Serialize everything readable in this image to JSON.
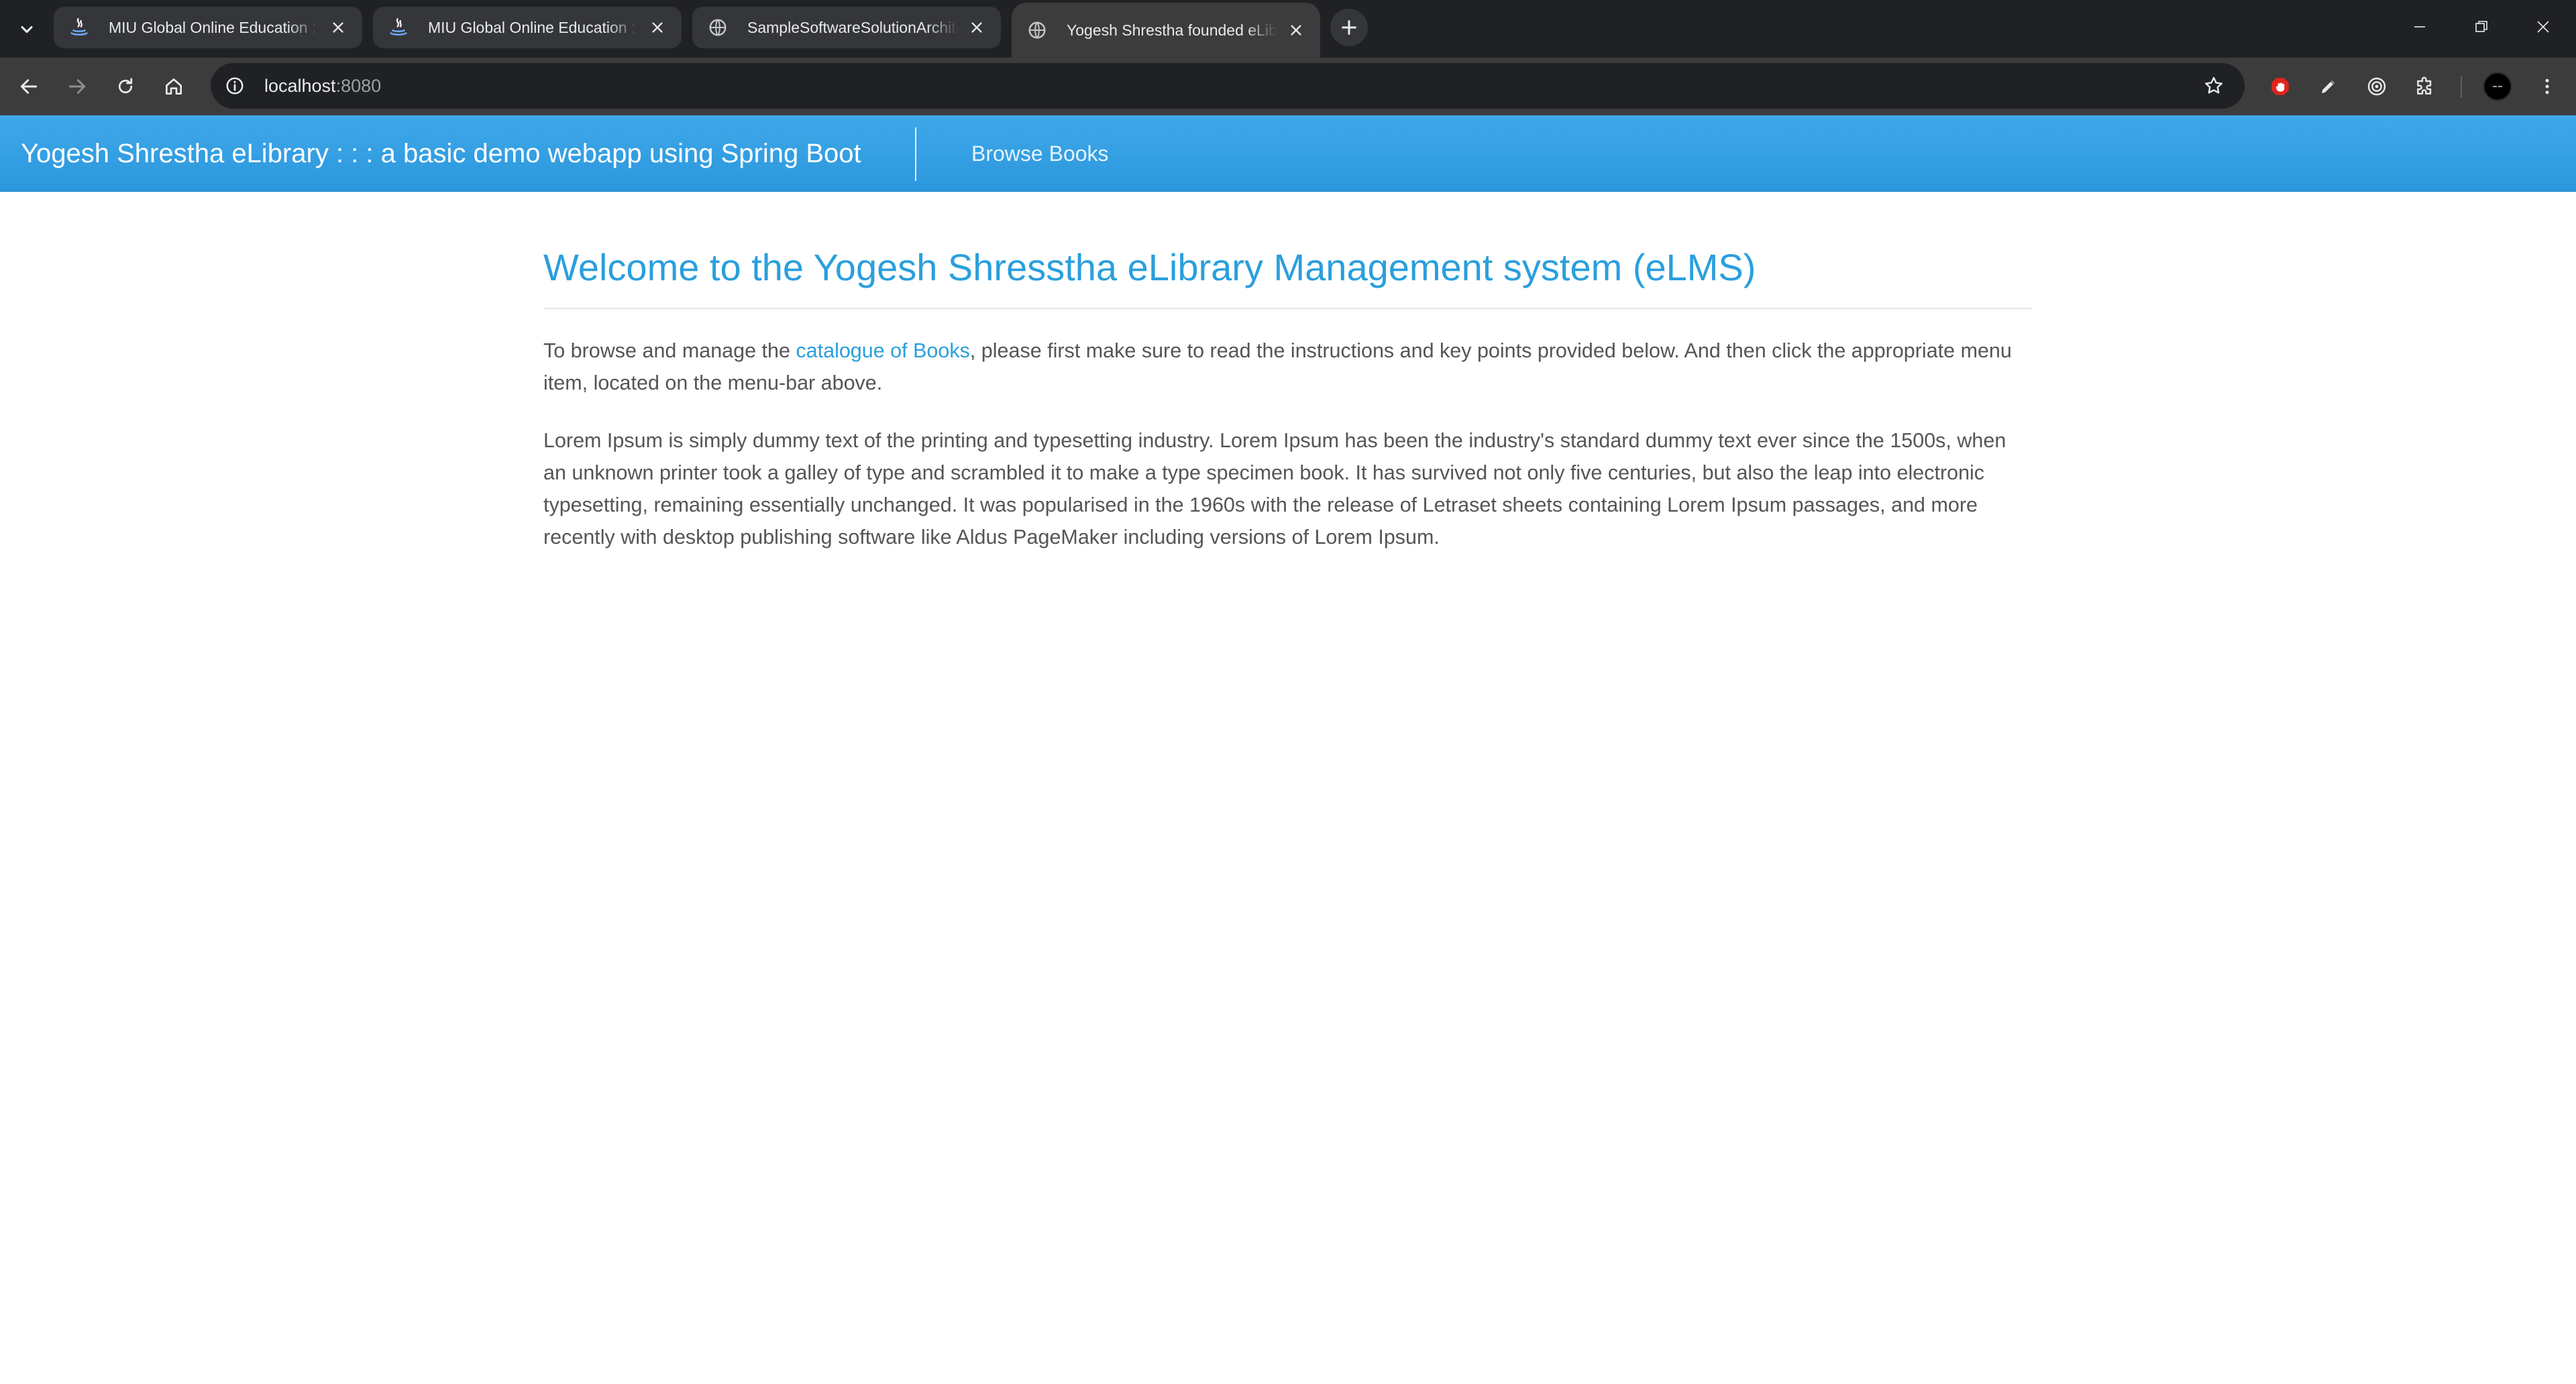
{
  "browser": {
    "tabs": [
      {
        "title": "MIU Global Online Education : Online Bachelor",
        "icon": "java-icon",
        "active": false
      },
      {
        "title": "MIU Global Online Education : Online Master",
        "icon": "java-icon",
        "active": false
      },
      {
        "title": "SampleSoftwareSolutionArchitecture",
        "icon": "globe-icon",
        "active": false
      },
      {
        "title": "Yogesh Shrestha founded eLibrary",
        "icon": "globe-icon",
        "active": true
      }
    ],
    "address_bar": {
      "host": "localhost",
      "port": ":8080"
    }
  },
  "navbar": {
    "brand": "Yogesh Shrestha eLibrary : : : a basic demo webapp using Spring Boot",
    "links": [
      "Browse Books"
    ]
  },
  "main": {
    "heading": "Welcome to the Yogesh Shresstha eLibrary Management system (eLMS)",
    "intro_before": "To browse and manage the ",
    "intro_link": "catalogue of Books",
    "intro_after": ", please first make sure to read the instructions and key points provided below. And then click the appropriate menu item, located on the menu-bar above.",
    "lorem": "Lorem Ipsum is simply dummy text of the printing and typesetting industry. Lorem Ipsum has been the industry's standard dummy text ever since the 1500s, when an unknown printer took a galley of type and scrambled it to make a type specimen book. It has survived not only five centuries, but also the leap into electronic typesetting, remaining essentially unchanged. It was popularised in the 1960s with the release of Letraset sheets containing Lorem Ipsum passages, and more recently with desktop publishing software like Aldus PageMaker including versions of Lorem Ipsum."
  },
  "colors": {
    "navbar": "#2b97dc",
    "accent": "#2a9fdd",
    "body_text": "#555555",
    "browser_frame": "#202124",
    "toolbar": "#3c3c3c"
  }
}
